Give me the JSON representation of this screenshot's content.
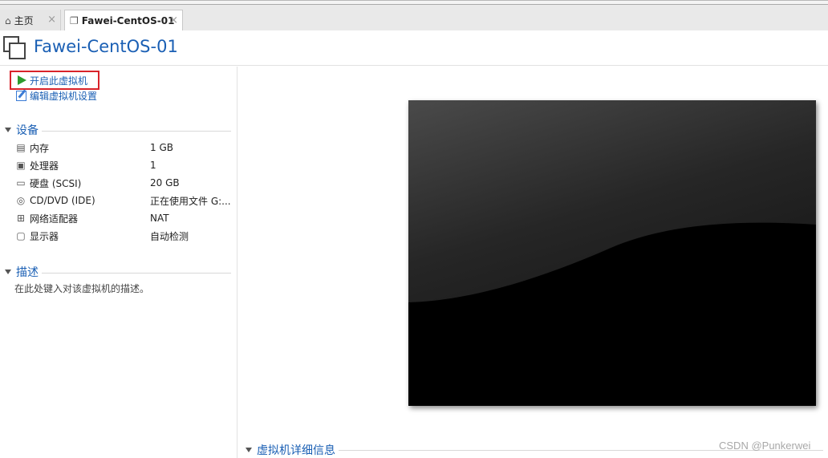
{
  "tabs": [
    {
      "label": "主页",
      "icon": "home-icon"
    },
    {
      "label": "Fawei-CentOS-01",
      "icon": "vm-icon",
      "active": true
    }
  ],
  "header": {
    "title": "Fawei-CentOS-01"
  },
  "actions": {
    "start_label": "开启此虚拟机",
    "edit_label": "编辑虚拟机设置"
  },
  "devices": {
    "section_label": "设备",
    "items": [
      {
        "name": "内存",
        "value": "1 GB",
        "icon": "memory-icon"
      },
      {
        "name": "处理器",
        "value": "1",
        "icon": "cpu-icon"
      },
      {
        "name": "硬盘 (SCSI)",
        "value": "20 GB",
        "icon": "hard-disk-icon"
      },
      {
        "name": "CD/DVD (IDE)",
        "value": "正在使用文件 G:...",
        "icon": "cd-dvd-icon"
      },
      {
        "name": "网络适配器",
        "value": "NAT",
        "icon": "network-adapter-icon"
      },
      {
        "name": "显示器",
        "value": "自动检测",
        "icon": "display-icon"
      }
    ]
  },
  "description": {
    "section_label": "描述",
    "placeholder": "在此处键入对该虚拟机的描述。"
  },
  "details": {
    "section_label": "虚拟机详细信息"
  },
  "watermark": "CSDN @Punkerwei",
  "colors": {
    "accent": "#1a5fb4",
    "play": "#2e9b2e",
    "highlight_border": "#d9232a"
  }
}
